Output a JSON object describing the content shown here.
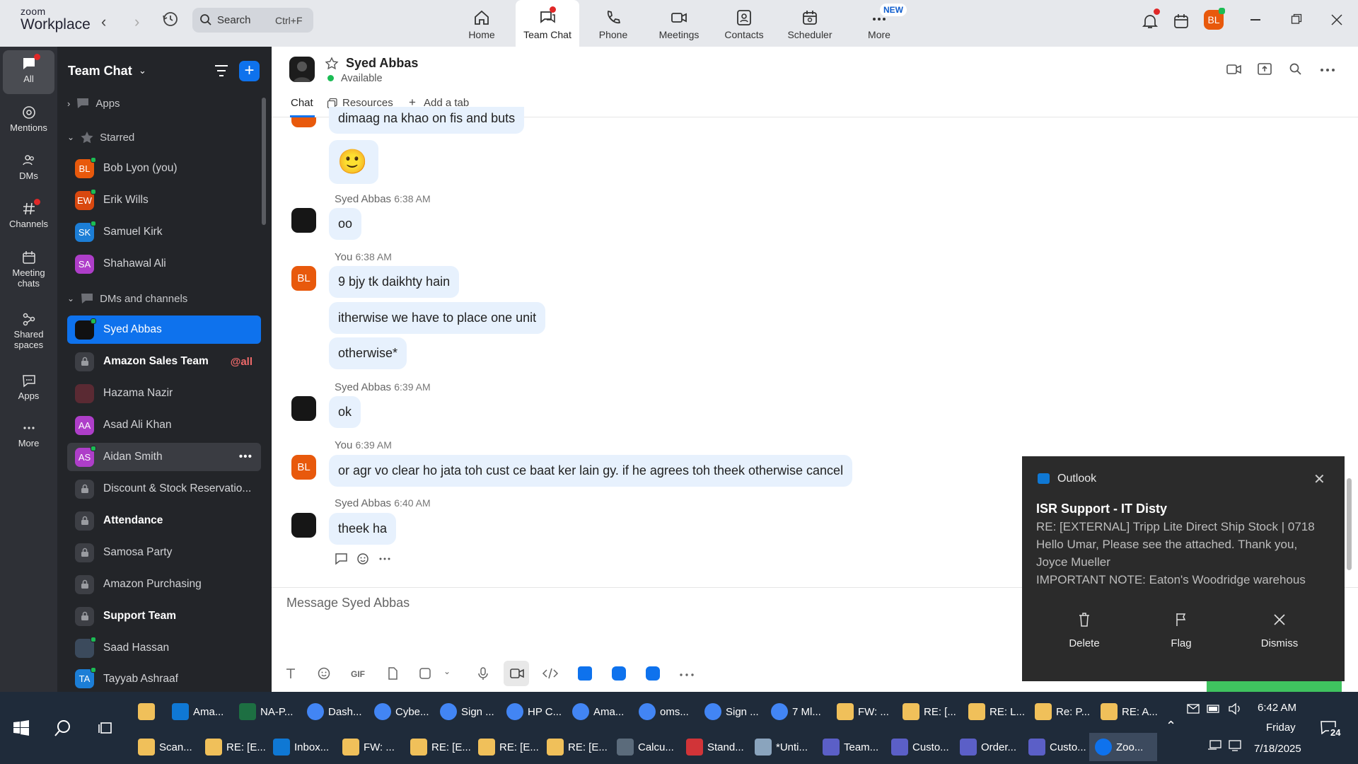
{
  "app": {
    "logo_top": "zoom",
    "logo_bottom": "Workplace"
  },
  "search": {
    "label": "Search",
    "shortcut": "Ctrl+F"
  },
  "nav_tabs": [
    {
      "label": "Home",
      "icon": "home-icon"
    },
    {
      "label": "Team Chat",
      "icon": "chat-icon"
    },
    {
      "label": "Phone",
      "icon": "phone-icon"
    },
    {
      "label": "Meetings",
      "icon": "video-icon"
    },
    {
      "label": "Contacts",
      "icon": "contacts-icon"
    },
    {
      "label": "Scheduler",
      "icon": "calendar-icon"
    },
    {
      "label": "More",
      "icon": "more-icon",
      "badge": "NEW"
    }
  ],
  "user_avatar": "BL",
  "rail": [
    {
      "label": "All",
      "icon": "chat-icon"
    },
    {
      "label": "Mentions",
      "icon": "at-icon"
    },
    {
      "label": "DMs",
      "icon": "people-icon"
    },
    {
      "label": "Channels",
      "icon": "hash-icon"
    },
    {
      "label": "Meeting chats",
      "icon": "calendar-icon"
    },
    {
      "label": "Shared spaces",
      "icon": "share-icon"
    },
    {
      "label": "Apps",
      "icon": "apps-icon"
    },
    {
      "label": "More",
      "icon": "more-icon"
    }
  ],
  "sidebar": {
    "title": "Team Chat",
    "apps_label": "Apps",
    "starred_label": "Starred",
    "starred": [
      {
        "initials": "BL",
        "name": "Bob Lyon (you)",
        "color": "#e8590c"
      },
      {
        "initials": "EW",
        "name": "Erik Wills",
        "color": "#d9480f"
      },
      {
        "initials": "SK",
        "name": "Samuel Kirk",
        "color": "#1c7ed6"
      },
      {
        "initials": "SA",
        "name": "Shahawal Ali",
        "color": "#ae3ec9"
      }
    ],
    "dms_label": "DMs and channels",
    "items": [
      {
        "name": "Syed Abbas",
        "type": "photo"
      },
      {
        "name": "Amazon Sales Team",
        "type": "lock",
        "bold": true,
        "tag": "@all"
      },
      {
        "name": "Hazama Nazir",
        "type": "photo2"
      },
      {
        "name": "Asad Ali Khan",
        "type": "initials",
        "initials": "AA",
        "color": "#ae3ec9"
      },
      {
        "name": "Aidan Smith",
        "type": "initials",
        "initials": "AS",
        "color": "#ae3ec9"
      },
      {
        "name": "Discount & Stock Reservatio...",
        "type": "lock"
      },
      {
        "name": "Attendance",
        "type": "lock",
        "bold": true
      },
      {
        "name": "Samosa Party",
        "type": "lock"
      },
      {
        "name": "Amazon Purchasing",
        "type": "lock"
      },
      {
        "name": "Support Team",
        "type": "lock",
        "bold": true
      },
      {
        "name": "Saad Hassan",
        "type": "photo3"
      },
      {
        "name": "Tayyab Ashraaf",
        "type": "initials",
        "initials": "TA",
        "color": "#1c7ed6"
      }
    ]
  },
  "chat": {
    "name": "Syed Abbas",
    "status": "Available",
    "tabs": [
      "Chat",
      "Resources",
      "Add a tab"
    ],
    "messages": [
      {
        "text": "dimaag na khao on fis and buts"
      },
      {
        "text": "🙂"
      },
      {
        "sender": "Syed Abbas",
        "time": "6:38 AM",
        "text": "oo"
      },
      {
        "sender": "You",
        "time": "6:38 AM",
        "text": "9 bjy tk daikhty hain"
      },
      {
        "text": "itherwise we have to place one unit"
      },
      {
        "text": "otherwise*"
      },
      {
        "sender": "Syed Abbas",
        "time": "6:39 AM",
        "text": "ok"
      },
      {
        "sender": "You",
        "time": "6:39 AM",
        "text": "or agr vo clear ho jata toh cust ce baat ker lain gy. if he agrees toh theek otherwise cancel"
      },
      {
        "sender": "Syed Abbas",
        "time": "6:40 AM",
        "text": "theek ha"
      }
    ],
    "composer_placeholder": "Message Syed Abbas",
    "gif_label": "GIF"
  },
  "toast": {
    "app": "Outlook",
    "sender": "ISR Support - IT Disty",
    "lines": [
      "RE: [EXTERNAL] Tripp Lite Direct Ship Stock | 0718",
      "Hello Umar,  Please see the attached.  Thank you,",
      "Joyce Mueller",
      "IMPORTANT NOTE:   Eaton's Woodridge warehous"
    ],
    "actions": [
      "Delete",
      "Flag",
      "Dismiss"
    ]
  },
  "taskbar": {
    "row1": [
      {
        "label": "Ama...",
        "color": "#0f78d4"
      },
      {
        "label": "NA-P...",
        "color": "#1d6f42"
      },
      {
        "label": "Dash...",
        "color": "#4285f4"
      },
      {
        "label": "Cybe...",
        "color": "#4285f4"
      },
      {
        "label": "Sign ...",
        "color": "#4285f4"
      },
      {
        "label": "HP C...",
        "color": "#4285f4"
      },
      {
        "label": "Ama...",
        "color": "#4285f4"
      },
      {
        "label": "oms...",
        "color": "#4285f4"
      },
      {
        "label": "Sign ...",
        "color": "#4285f4"
      },
      {
        "label": "7 Ml...",
        "color": "#4285f4"
      },
      {
        "label": "FW: ...",
        "color": "#f0c05a"
      },
      {
        "label": "RE: [...",
        "color": "#f0c05a"
      },
      {
        "label": "RE: L...",
        "color": "#f0c05a"
      },
      {
        "label": "Re: P...",
        "color": "#f0c05a"
      },
      {
        "label": "RE: A...",
        "color": "#f0c05a"
      }
    ],
    "row2": [
      {
        "label": "Scan...",
        "color": "#f0c05a"
      },
      {
        "label": "RE: [E...",
        "color": "#f0c05a"
      },
      {
        "label": "Inbox...",
        "color": "#0f78d4"
      },
      {
        "label": "FW: ...",
        "color": "#f0c05a"
      },
      {
        "label": "RE: [E...",
        "color": "#f0c05a"
      },
      {
        "label": "RE: [E...",
        "color": "#f0c05a"
      },
      {
        "label": "RE: [E...",
        "color": "#f0c05a"
      },
      {
        "label": "Calcu...",
        "color": "#5b6b7b"
      },
      {
        "label": "Stand...",
        "color": "#d13438"
      },
      {
        "label": "*Unti...",
        "color": "#8aa4bd"
      },
      {
        "label": "Team...",
        "color": "#5b5fc7"
      },
      {
        "label": "Custo...",
        "color": "#5b5fc7"
      },
      {
        "label": "Order...",
        "color": "#5b5fc7"
      },
      {
        "label": "Custo...",
        "color": "#5b5fc7"
      },
      {
        "label": "Zoo...",
        "color": "#0e72ed"
      }
    ],
    "time": "6:42 AM",
    "day": "Friday",
    "date": "7/18/2025",
    "notif_count": "24"
  }
}
